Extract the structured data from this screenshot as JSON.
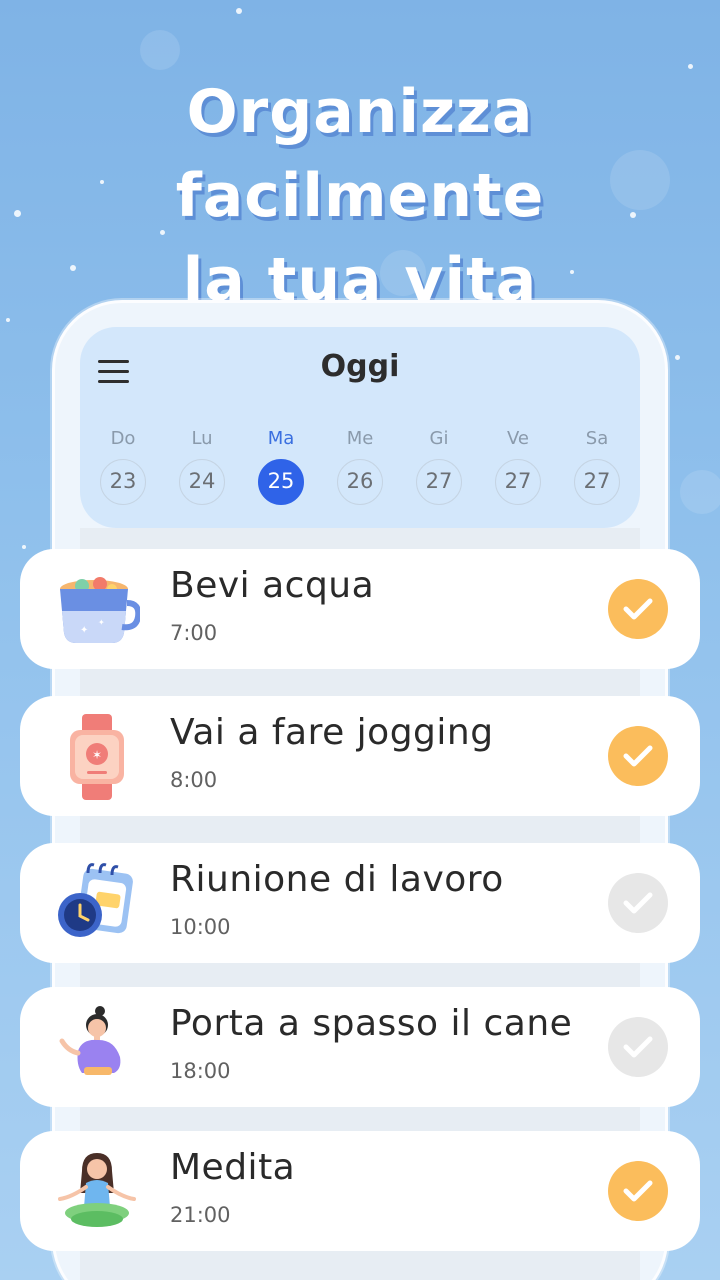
{
  "headline": {
    "line1": "Organizza facilmente",
    "line2": "la tua vita"
  },
  "calendar": {
    "title": "Oggi",
    "days": [
      {
        "name": "Do",
        "date": "23",
        "selected": false
      },
      {
        "name": "Lu",
        "date": "24",
        "selected": false
      },
      {
        "name": "Ma",
        "date": "25",
        "selected": true
      },
      {
        "name": "Me",
        "date": "26",
        "selected": false
      },
      {
        "name": "Gi",
        "date": "27",
        "selected": false
      },
      {
        "name": "Ve",
        "date": "27",
        "selected": false
      },
      {
        "name": "Sa",
        "date": "27",
        "selected": false
      }
    ]
  },
  "tasks": [
    {
      "title": "Bevi acqua",
      "time": "7:00",
      "done": true,
      "icon": "cup-icon"
    },
    {
      "title": "Vai a fare jogging",
      "time": "8:00",
      "done": true,
      "icon": "smartwatch-icon"
    },
    {
      "title": "Riunione di lavoro",
      "time": "10:00",
      "done": false,
      "icon": "clock-notepad-icon"
    },
    {
      "title": "Porta a spasso il cane",
      "time": "18:00",
      "done": false,
      "icon": "woman-icon"
    },
    {
      "title": "Medita",
      "time": "21:00",
      "done": true,
      "icon": "meditation-icon"
    }
  ],
  "colors": {
    "accent": "#2f63e8",
    "check_done": "#fbbd5c",
    "check_pending": "#e7e7e7"
  }
}
